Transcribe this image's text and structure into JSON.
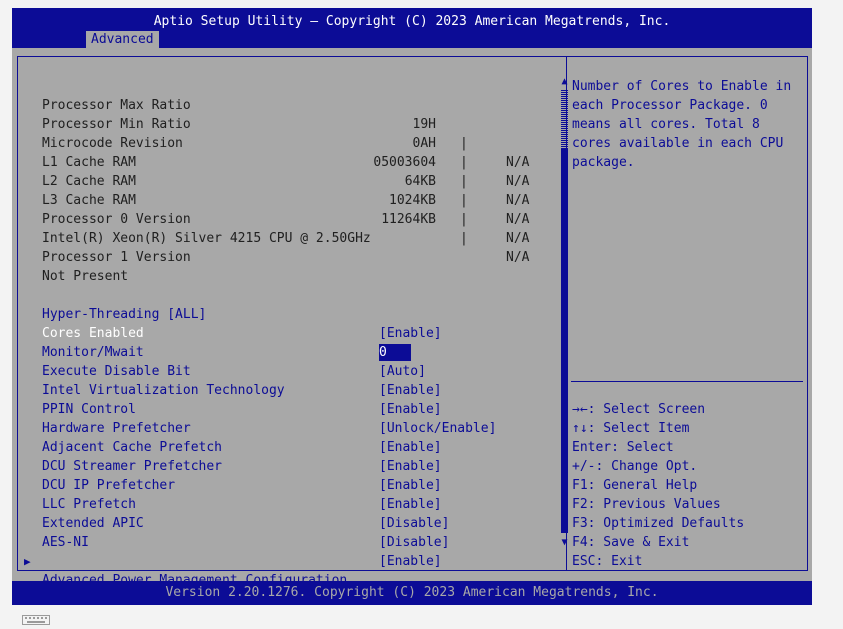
{
  "header": {
    "title": "Aptio Setup Utility – Copyright (C) 2023 American Megatrends, Inc.",
    "tab": "Advanced"
  },
  "info_rows": [
    {
      "label": "Processor Max Ratio",
      "value": "19H",
      "na": "N/A"
    },
    {
      "label": "Processor Min Ratio",
      "value": "0AH",
      "na": "N/A"
    },
    {
      "label": "Microcode Revision",
      "value": "05003604",
      "na": "N/A"
    },
    {
      "label": "L1 Cache RAM",
      "value": "64KB",
      "na": "N/A"
    },
    {
      "label": "L2 Cache RAM",
      "value": "1024KB",
      "na": "N/A"
    },
    {
      "label": "L3 Cache RAM",
      "value": "11264KB",
      "na": "N/A"
    }
  ],
  "info_separator": "|",
  "static_lines": [
    "Processor 0 Version",
    "Intel(R) Xeon(R) Silver 4215 CPU @ 2.50GHz",
    "Processor 1 Version",
    "Not Present"
  ],
  "options": [
    {
      "label": "Hyper-Threading [ALL]",
      "value": "[Enable]"
    },
    {
      "label": "Cores Enabled",
      "value": "0",
      "selected": true
    },
    {
      "label": "Monitor/Mwait",
      "value": "[Auto]"
    },
    {
      "label": "Execute Disable Bit",
      "value": "[Enable]"
    },
    {
      "label": "Intel Virtualization Technology",
      "value": "[Enable]"
    },
    {
      "label": "PPIN Control",
      "value": "[Unlock/Enable]"
    },
    {
      "label": "Hardware Prefetcher",
      "value": "[Enable]"
    },
    {
      "label": "Adjacent Cache Prefetch",
      "value": "[Enable]"
    },
    {
      "label": "DCU Streamer Prefetcher",
      "value": "[Enable]"
    },
    {
      "label": "DCU IP Prefetcher",
      "value": "[Enable]"
    },
    {
      "label": "LLC Prefetch",
      "value": "[Disable]"
    },
    {
      "label": "Extended APIC",
      "value": "[Disable]"
    },
    {
      "label": "AES-NI",
      "value": "[Enable]"
    }
  ],
  "submenu": {
    "label": "Advanced Power Management Configuration"
  },
  "help": {
    "text": "Number of Cores to Enable in each Processor Package. 0 means all cores. Total 8 cores available in each CPU package.",
    "keys": [
      "→←: Select Screen",
      "↑↓: Select Item",
      "Enter: Select",
      "+/-: Change Opt.",
      "F1: General Help",
      "F2: Previous Values",
      "F3: Optimized Defaults",
      "F4: Save & Exit",
      "ESC: Exit"
    ]
  },
  "footer": {
    "version": "Version 2.20.1276. Copyright (C) 2023 American Megatrends, Inc."
  },
  "colors": {
    "bios_blue": "#0c0c96",
    "bios_gray": "#a8a8a8",
    "selected_text": "#ffffff"
  },
  "icons": {
    "scroll_up": "▲",
    "scroll_down": "▼",
    "submenu_arrow": "▶"
  }
}
